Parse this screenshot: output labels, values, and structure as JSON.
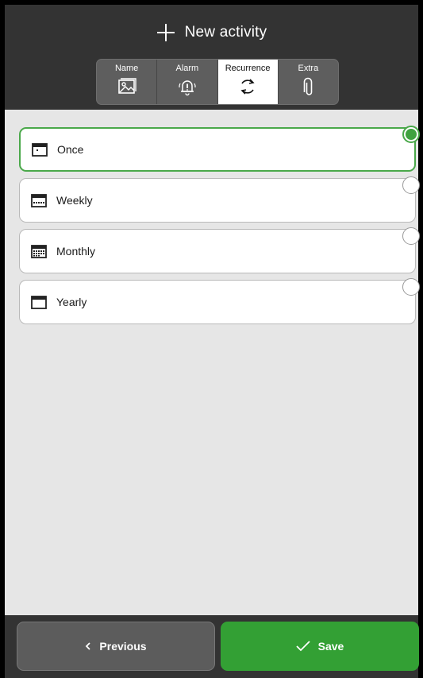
{
  "header": {
    "title": "New activity"
  },
  "tabs": [
    {
      "label": "Name",
      "icon": "image-icon"
    },
    {
      "label": "Alarm",
      "icon": "alarm-bell-icon"
    },
    {
      "label": "Recurrence",
      "icon": "recurrence-icon"
    },
    {
      "label": "Extra",
      "icon": "paperclip-icon"
    }
  ],
  "active_tab": "Recurrence",
  "options": [
    {
      "label": "Once",
      "icon": "calendar-once-icon",
      "selected": true
    },
    {
      "label": "Weekly",
      "icon": "calendar-weekly-icon",
      "selected": false
    },
    {
      "label": "Monthly",
      "icon": "calendar-monthly-icon",
      "selected": false
    },
    {
      "label": "Yearly",
      "icon": "calendar-yearly-icon",
      "selected": false
    }
  ],
  "footer": {
    "previous_label": "Previous",
    "save_label": "Save"
  },
  "colors": {
    "header_bg": "#333333",
    "content_bg": "#e6e6e6",
    "accent_green": "#33a034",
    "selected_border": "#4aa84a"
  }
}
